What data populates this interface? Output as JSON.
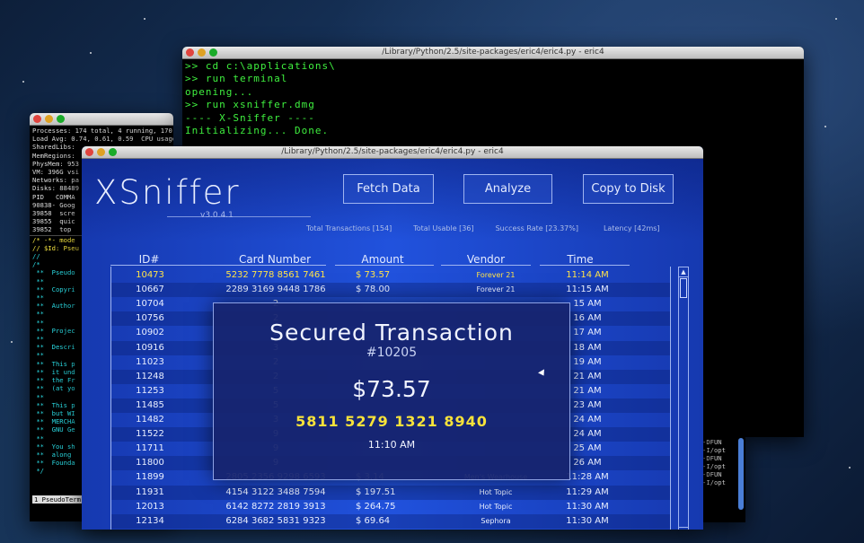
{
  "background": {
    "accent": "#1c45c8"
  },
  "back_terminal": {
    "lines": [
      "Processes: 174 total, 4 running, 170",
      "Load Avg: 0.74, 0.61, 0.59  CPU usage",
      "SharedLibs: ",
      "MemRegions: ",
      "PhysMem: 953",
      "VM: 396G vsi",
      "Networks: pa",
      "Disks: 88489",
      "",
      "PID   COMMA",
      "90838- Goog",
      "39858  scre",
      "39855  quic",
      "39852  top"
    ],
    "nano_lines": [
      "/* -*- mode",
      "// $Id: Pseu",
      "//",
      "/*",
      " **  Pseudo",
      " **",
      " **  Copyri",
      " **",
      " **  Author",
      " **",
      " **",
      " **  Projec",
      " **",
      " **  Descri",
      " **",
      " **  This p",
      " **  it und",
      " **  the Fr",
      " **  (at yo",
      " **",
      " **  This p",
      " **  but WI",
      " **  MERCHA",
      " **  GNU Ge",
      " **",
      " **  You sh",
      " **  along",
      " **  Founda",
      " */"
    ],
    "status": "1 PseudoTerm"
  },
  "cmd_window": {
    "title": "/Library/Python/2.5/site-packages/eric4/eric4.py - eric4",
    "lines": [
      ">> cd c:\\applications\\",
      ">> run terminal",
      "opening...",
      ">> run xsniffer.dmg",
      "",
      "---- X-Sniffer ----",
      "Initializing... Done."
    ]
  },
  "right_remnant": {
    "lines": [
      "-DFUN",
      "-I/opt",
      "",
      "-DFUN",
      "-I/opt",
      "",
      "-DFUN",
      "-I/opt"
    ]
  },
  "main_window": {
    "title": "/Library/Python/2.5/site-packages/eric4/eric4.py - eric4",
    "logo": "XSniffer",
    "version": "v3.0.4.1",
    "buttons": {
      "fetch": "Fetch Data",
      "analyze": "Analyze",
      "copy": "Copy to Disk"
    },
    "stats": {
      "total_label": "Total Transactions",
      "total_value": "[154]",
      "usable_label": "Total Usable",
      "usable_value": "[36]",
      "rate_label": "Success Rate",
      "rate_value": "[23.37%]",
      "latency_label": "Latency",
      "latency_value": "[42ms]"
    },
    "columns": [
      "ID#",
      "Card Number",
      "Amount",
      "Vendor",
      "Time"
    ],
    "rows": [
      {
        "id": "10473",
        "card": "5232 7778 8561 7461",
        "amount": "$  73.57",
        "vendor": "Forever 21",
        "time": "11:14 AM",
        "highlight": true
      },
      {
        "id": "10667",
        "card": "2289 3169 9448 1786",
        "amount": "$  78.00",
        "vendor": "Forever 21",
        "time": "11:15 AM"
      },
      {
        "id": "10704",
        "card": "2",
        "amount": "",
        "vendor": "",
        "time": "15 AM"
      },
      {
        "id": "10756",
        "card": "2",
        "amount": "",
        "vendor": "",
        "time": "16 AM"
      },
      {
        "id": "10902",
        "card": "2",
        "amount": "",
        "vendor": "",
        "time": "17 AM"
      },
      {
        "id": "10916",
        "card": "3",
        "amount": "",
        "vendor": "",
        "time": "18 AM"
      },
      {
        "id": "11023",
        "card": "2",
        "amount": "",
        "vendor": "",
        "time": "19 AM"
      },
      {
        "id": "11248",
        "card": "2",
        "amount": "",
        "vendor": "",
        "time": "21 AM"
      },
      {
        "id": "11253",
        "card": "5",
        "amount": "",
        "vendor": "",
        "time": "21 AM"
      },
      {
        "id": "11485",
        "card": "5",
        "amount": "",
        "vendor": "",
        "time": "23 AM"
      },
      {
        "id": "11482",
        "card": "3",
        "amount": "",
        "vendor": "",
        "time": "24 AM"
      },
      {
        "id": "11522",
        "card": "9",
        "amount": "",
        "vendor": "",
        "time": "24 AM"
      },
      {
        "id": "11711",
        "card": "9",
        "amount": "",
        "vendor": "",
        "time": "25 AM"
      },
      {
        "id": "11800",
        "card": "9",
        "amount": "",
        "vendor": "",
        "time": "26 AM"
      },
      {
        "id": "11899",
        "card": "2805 2356 9298 6593",
        "amount": "$   3.14",
        "vendor": "Men's Wearhouse",
        "time": "11:28 AM"
      },
      {
        "id": "11931",
        "card": "4154 3122 3488 7594",
        "amount": "$ 197.51",
        "vendor": "Hot Topic",
        "time": "11:29 AM"
      },
      {
        "id": "12013",
        "card": "6142 8272 2819 3913",
        "amount": "$ 264.75",
        "vendor": "Hot Topic",
        "time": "11:30 AM"
      },
      {
        "id": "12134",
        "card": "6284 3682 5831 9323",
        "amount": "$  69.64",
        "vendor": "Sephora",
        "time": "11:30 AM"
      }
    ],
    "modal": {
      "title": "Secured Transaction",
      "id": "#10205",
      "amount": "$73.57",
      "card": "5811 5279 1321 8940",
      "time": "11:10 AM"
    }
  }
}
